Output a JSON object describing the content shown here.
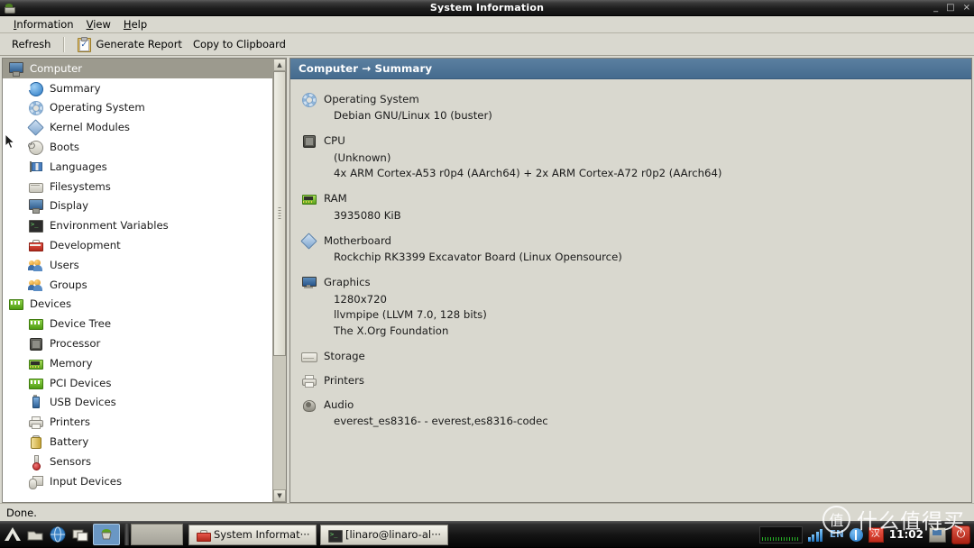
{
  "window": {
    "title": "System Information",
    "app_icon": "sysinfo-pot-icon",
    "controls": {
      "minimize": "_",
      "maximize": "□",
      "close": "×"
    }
  },
  "menubar": {
    "items": [
      {
        "label": "Information",
        "accel": "I"
      },
      {
        "label": "View",
        "accel": "V"
      },
      {
        "label": "Help",
        "accel": "H"
      }
    ]
  },
  "toolbar": {
    "refresh_label": "Refresh",
    "generate_report_label": "Generate Report",
    "copy_clipboard_label": "Copy to Clipboard"
  },
  "sidebar": {
    "scroll": {
      "up_arrow": "▲",
      "down_arrow": "▼",
      "thumb_top_pct": 0,
      "thumb_height_pct": 68
    },
    "items": [
      {
        "label": "Computer",
        "icon": "computer-monitor-icon",
        "level": "group",
        "selected": true
      },
      {
        "label": "Summary",
        "icon": "info-icon",
        "level": "child",
        "selected": false
      },
      {
        "label": "Operating System",
        "icon": "gear-icon",
        "level": "child",
        "selected": false
      },
      {
        "label": "Kernel Modules",
        "icon": "diamond-icon",
        "level": "child",
        "selected": false
      },
      {
        "label": "Boots",
        "icon": "power-icon",
        "level": "child",
        "selected": false
      },
      {
        "label": "Languages",
        "icon": "flag-icon",
        "level": "child",
        "selected": false
      },
      {
        "label": "Filesystems",
        "icon": "disk-icon",
        "level": "child",
        "selected": false
      },
      {
        "label": "Display",
        "icon": "display-monitor-icon",
        "level": "child",
        "selected": false
      },
      {
        "label": "Environment Variables",
        "icon": "terminal-icon",
        "level": "child",
        "selected": false
      },
      {
        "label": "Development",
        "icon": "toolbox-icon",
        "level": "child",
        "selected": false
      },
      {
        "label": "Users",
        "icon": "users-icon",
        "level": "child",
        "selected": false
      },
      {
        "label": "Groups",
        "icon": "users-icon",
        "level": "child",
        "selected": false
      },
      {
        "label": "Devices",
        "icon": "chip-icon",
        "level": "group",
        "selected": false
      },
      {
        "label": "Device Tree",
        "icon": "chip-icon",
        "level": "child",
        "selected": false
      },
      {
        "label": "Processor",
        "icon": "cpu-icon",
        "level": "child",
        "selected": false
      },
      {
        "label": "Memory",
        "icon": "memory-icon",
        "level": "child",
        "selected": false
      },
      {
        "label": "PCI Devices",
        "icon": "chip-icon",
        "level": "child",
        "selected": false
      },
      {
        "label": "USB Devices",
        "icon": "usb-icon",
        "level": "child",
        "selected": false
      },
      {
        "label": "Printers",
        "icon": "printer-icon",
        "level": "child",
        "selected": false
      },
      {
        "label": "Battery",
        "icon": "battery-icon",
        "level": "child",
        "selected": false
      },
      {
        "label": "Sensors",
        "icon": "thermometer-icon",
        "level": "child",
        "selected": false
      },
      {
        "label": "Input Devices",
        "icon": "input-devices-icon",
        "level": "child",
        "selected": false
      }
    ]
  },
  "main": {
    "header": "Computer → Summary",
    "sections": [
      {
        "title": "Operating System",
        "icon": "gear-icon",
        "values": [
          "Debian GNU/Linux 10 (buster)"
        ]
      },
      {
        "title": "CPU",
        "icon": "cpu-icon",
        "values": [
          "(Unknown)",
          "4x ARM Cortex-A53 r0p4 (AArch64) + 2x ARM Cortex-A72 r0p2 (AArch64)"
        ]
      },
      {
        "title": "RAM",
        "icon": "memory-icon",
        "values": [
          "3935080 KiB"
        ]
      },
      {
        "title": "Motherboard",
        "icon": "diamond-icon",
        "values": [
          "Rockchip RK3399 Excavator Board (Linux Opensource)"
        ]
      },
      {
        "title": "Graphics",
        "icon": "graphics-monitor-icon",
        "values": [
          "1280x720",
          "llvmpipe (LLVM 7.0, 128 bits)",
          "The X.Org Foundation"
        ]
      },
      {
        "title": "Storage",
        "icon": "storage-icon",
        "values": []
      },
      {
        "title": "Printers",
        "icon": "printer-icon",
        "values": []
      },
      {
        "title": "Audio",
        "icon": "audio-speaker-icon",
        "values": [
          "everest_es8316- - everest,es8316-codec"
        ]
      }
    ]
  },
  "statusbar": {
    "text": "Done."
  },
  "taskbar": {
    "launchers": [
      {
        "name": "menu-launcher-icon"
      },
      {
        "name": "file-manager-icon"
      },
      {
        "name": "web-browser-icon"
      },
      {
        "name": "window-list-icon"
      },
      {
        "name": "system-information-launcher-icon"
      }
    ],
    "windows": [
      {
        "label": "System Informat···",
        "icon": "sysinfo-pot-icon",
        "active": true
      },
      {
        "label": "[linaro@linaro-al···",
        "icon": "terminal-icon",
        "active": false
      }
    ],
    "tray": {
      "network_graph": "network-monitor-graph",
      "signal_icon": "signal-bars-icon",
      "input_method": "EN",
      "bluetooth_icon": "bluetooth-icon",
      "ime_icon": "chinese-ime-icon",
      "clock": "11:02",
      "display_icon": "display-settings-icon",
      "power_icon": "power-button-icon"
    }
  },
  "watermark": {
    "badge": "值",
    "text": "什么值得买"
  },
  "colors": {
    "window_bg": "#d9d8cf",
    "panel_header": "#456b8e",
    "selection": "#9c9a8e",
    "titlebar": "#1d1d1d",
    "taskbar": "#141414"
  }
}
